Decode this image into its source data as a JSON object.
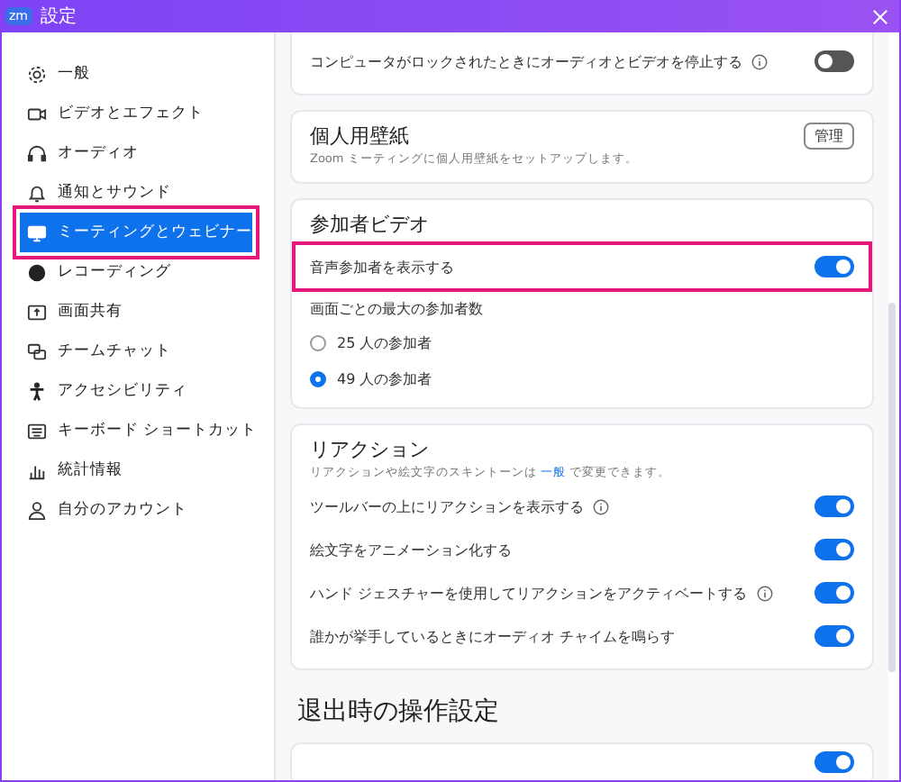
{
  "window": {
    "app_badge": "zm",
    "title": "設定"
  },
  "sidebar": {
    "items": [
      {
        "label": "一般",
        "selected": false,
        "highlighted": false
      },
      {
        "label": "ビデオとエフェクト",
        "selected": false,
        "highlighted": false
      },
      {
        "label": "オーディオ",
        "selected": false,
        "highlighted": false
      },
      {
        "label": "通知とサウンド",
        "selected": false,
        "highlighted": false
      },
      {
        "label": "ミーティングとウェビナー",
        "selected": true,
        "highlighted": true
      },
      {
        "label": "レコーディング",
        "selected": false,
        "highlighted": false
      },
      {
        "label": "画面共有",
        "selected": false,
        "highlighted": false
      },
      {
        "label": "チームチャット",
        "selected": false,
        "highlighted": false
      },
      {
        "label": "アクセシビリティ",
        "selected": false,
        "highlighted": false
      },
      {
        "label": "キーボード ショートカット",
        "selected": false,
        "highlighted": false
      },
      {
        "label": "統計情報",
        "selected": false,
        "highlighted": false
      },
      {
        "label": "自分のアカウント",
        "selected": false,
        "highlighted": false
      }
    ]
  },
  "cards": [
    {
      "rows": [
        {
          "kind": "toggle",
          "label": "コンピュータがロックされたときにオーディオとビデオを停止する",
          "info": true,
          "on": false,
          "highlighted": false
        }
      ]
    },
    {
      "title": "個人用壁紙",
      "subtitle": "Zoom ミーティングに個人用壁紙をセットアップします。",
      "button": "管理"
    },
    {
      "title": "参加者ビデオ",
      "rows": [
        {
          "kind": "toggle",
          "label": "音声参加者を表示する",
          "info": false,
          "on": true,
          "highlighted": true
        },
        {
          "kind": "label",
          "label": "画面ごとの最大の参加者数"
        },
        {
          "kind": "radio",
          "label": "25 人の参加者",
          "selected": false
        },
        {
          "kind": "radio",
          "label": "49 人の参加者",
          "selected": true
        }
      ]
    },
    {
      "title": "リアクション",
      "subtitle_parts": [
        "リアクションや絵文字のスキントーンは",
        "一般",
        "で変更できます。"
      ],
      "rows": [
        {
          "kind": "toggle",
          "label": "ツールバーの上にリアクションを表示する",
          "info": true,
          "on": true,
          "highlighted": false
        },
        {
          "kind": "toggle",
          "label": "絵文字をアニメーション化する",
          "info": false,
          "on": true,
          "highlighted": false
        },
        {
          "kind": "toggle",
          "label": "ハンド ジェスチャーを使用してリアクションをアクティベートする",
          "info": true,
          "on": true,
          "highlighted": false
        },
        {
          "kind": "toggle",
          "label": "誰かが挙手しているときにオーディオ チャイムを鳴らす",
          "info": false,
          "on": true,
          "highlighted": false
        }
      ]
    }
  ],
  "section_heading": "退出時の操作設定",
  "cut_card": {
    "on": true
  }
}
